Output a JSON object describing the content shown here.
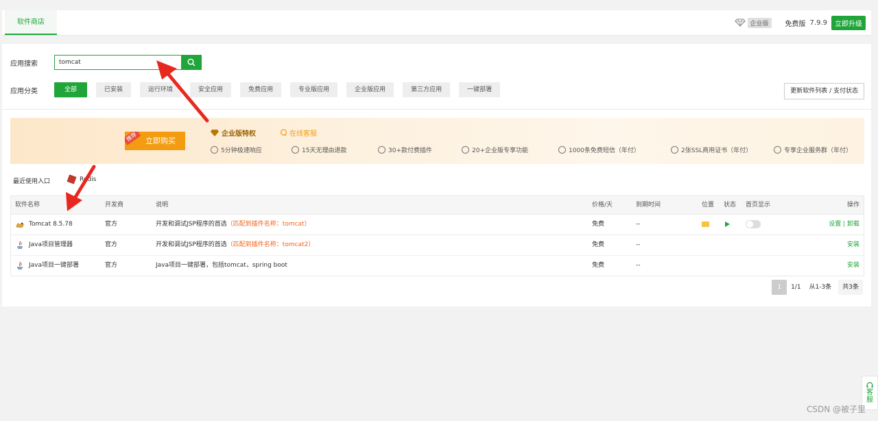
{
  "topbar": {
    "tab_label": "软件商店",
    "enterprise_badge": "企业版",
    "free_label": "免费版",
    "version": "7.9.9",
    "upgrade_label": "立即升级"
  },
  "search": {
    "label": "应用搜索",
    "value": "tomcat"
  },
  "category": {
    "label": "应用分类",
    "items": [
      "全部",
      "已安装",
      "运行环境",
      "安全应用",
      "免费应用",
      "专业版应用",
      "企业版应用",
      "第三方应用",
      "一键部署"
    ],
    "active_index": 0
  },
  "update_button": "更新软件列表 / 支付状态",
  "banner": {
    "buy_label": "立即购买",
    "recommend_tag": "推荐",
    "enterprise_title": "企业版特权",
    "online_service": "在线客服",
    "perks": [
      "5分钟极速响应",
      "15天无理由退款",
      "30+款付费插件",
      "20+企业版专享功能",
      "1000条免费短信（年付）",
      "2张SSL商用证书（年付）",
      "专享企业服务群（年付）"
    ]
  },
  "recent": {
    "label": "最近使用入口",
    "item": "Redis"
  },
  "table": {
    "headers": {
      "name": "软件名称",
      "developer": "开发商",
      "description": "说明",
      "price": "价格/天",
      "expire": "到期时间",
      "location": "位置",
      "status": "状态",
      "home": "首页显示",
      "operation": "操作"
    },
    "rows": [
      {
        "name": "Tomcat 8.5.78",
        "developer": "官方",
        "description": "开发和调试JSP程序的首选",
        "match": "（匹配到插件名称：tomcat）",
        "price": "免费",
        "expire": "--",
        "op1": "设置",
        "op_sep": " | ",
        "op2": "卸载"
      },
      {
        "name": "Java项目管理器",
        "developer": "官方",
        "description": "开发和调试JSP程序的首选",
        "match": "（匹配到插件名称：tomcat2）",
        "price": "免费",
        "expire": "--",
        "op1": "安装"
      },
      {
        "name": "Java项目一键部署",
        "developer": "官方",
        "description": "Java项目一键部署，包括tomcat，spring boot",
        "match": "",
        "price": "免费",
        "expire": "--",
        "op1": "安装"
      }
    ]
  },
  "pagination": {
    "current": "1",
    "pages": "1/1",
    "range": "从1-3条",
    "total": "共3条"
  },
  "side_service": [
    "客",
    "服"
  ],
  "watermark": "CSDN @被子里",
  "colors": {
    "accent": "#20a53a",
    "match": "#f0641e",
    "arrow": "#e8281e",
    "banner_button": "#f39c12"
  }
}
